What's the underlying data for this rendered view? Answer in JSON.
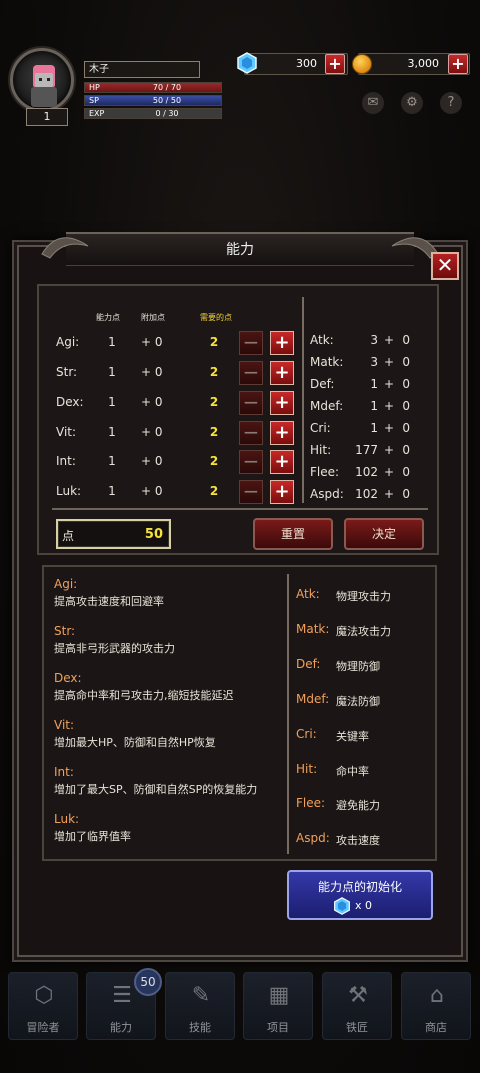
{
  "player": {
    "name": "木子",
    "level": "1",
    "hp_label": "HP",
    "hp_value": "70 / 70",
    "sp_label": "SP",
    "sp_value": "50 / 50",
    "exp_label": "EXP",
    "exp_value": "0 / 30"
  },
  "currency": {
    "gems": "300",
    "gold": "3,000"
  },
  "dialog": {
    "title": "能力",
    "columns": {
      "points": "能力点",
      "bonus": "附加点",
      "required": "需要的点"
    },
    "stats": [
      {
        "name": "Agi:",
        "base": "1",
        "bonus": "+ 0",
        "required": "2"
      },
      {
        "name": "Str:",
        "base": "1",
        "bonus": "+ 0",
        "required": "2"
      },
      {
        "name": "Dex:",
        "base": "1",
        "bonus": "+ 0",
        "required": "2"
      },
      {
        "name": "Vit:",
        "base": "1",
        "bonus": "+ 0",
        "required": "2"
      },
      {
        "name": "Int:",
        "base": "1",
        "bonus": "+ 0",
        "required": "2"
      },
      {
        "name": "Luk:",
        "base": "1",
        "bonus": "+ 0",
        "required": "2"
      }
    ],
    "derived": [
      {
        "name": "Atk:",
        "value": "3",
        "plus": "+",
        "bonus": "0"
      },
      {
        "name": "Matk:",
        "value": "3",
        "plus": "+",
        "bonus": "0"
      },
      {
        "name": "Def:",
        "value": "1",
        "plus": "+",
        "bonus": "0"
      },
      {
        "name": "Mdef:",
        "value": "1",
        "plus": "+",
        "bonus": "0"
      },
      {
        "name": "Cri:",
        "value": "1",
        "plus": "+",
        "bonus": "0"
      },
      {
        "name": "Hit:",
        "value": "177",
        "plus": "+",
        "bonus": "0"
      },
      {
        "name": "Flee:",
        "value": "102",
        "plus": "+",
        "bonus": "0"
      },
      {
        "name": "Aspd:",
        "value": "102",
        "plus": "+",
        "bonus": "0"
      }
    ],
    "points_label": "点",
    "points_value": "50",
    "reset_label": "重置",
    "confirm_label": "决定",
    "descriptions": [
      {
        "title": "Agi:",
        "text": "提高攻击速度和回避率"
      },
      {
        "title": "Str:",
        "text": "提高非弓形武器的攻击力"
      },
      {
        "title": "Dex:",
        "text": "提高命中率和弓攻击力,缩短技能延迟"
      },
      {
        "title": "Vit:",
        "text": "增加最大HP、防御和自然HP恢复"
      },
      {
        "title": "Int:",
        "text": "增加了最大SP、防御和自然SP的恢复能力"
      },
      {
        "title": "Luk:",
        "text": "增加了临界值率"
      }
    ],
    "terms": [
      {
        "name": "Atk:",
        "text": "物理攻击力"
      },
      {
        "name": "Matk:",
        "text": "魔法攻击力"
      },
      {
        "name": "Def:",
        "text": "物理防御"
      },
      {
        "name": "Mdef:",
        "text": "魔法防御"
      },
      {
        "name": "Cri:",
        "text": "关键率"
      },
      {
        "name": "Hit:",
        "text": "命中率"
      },
      {
        "name": "Flee:",
        "text": "避免能力"
      },
      {
        "name": "Aspd:",
        "text": "攻击速度"
      }
    ],
    "init_button_label": "能力点的初始化",
    "init_cost": "x 0"
  },
  "nav": {
    "items": [
      {
        "label": "冒险者",
        "icon": "adventurer-icon"
      },
      {
        "label": "能力",
        "icon": "ability-icon"
      },
      {
        "label": "技能",
        "icon": "skill-icon"
      },
      {
        "label": "项目",
        "icon": "items-icon"
      },
      {
        "label": "铁匠",
        "icon": "anvil-icon"
      },
      {
        "label": "商店",
        "icon": "shop-icon"
      }
    ],
    "ability_badge": "50"
  },
  "colors": {
    "accent_red": "#c62a2a",
    "gold_text": "#f5e23a",
    "orange_text": "#f2a05a",
    "blue_button": "#3438a8"
  }
}
